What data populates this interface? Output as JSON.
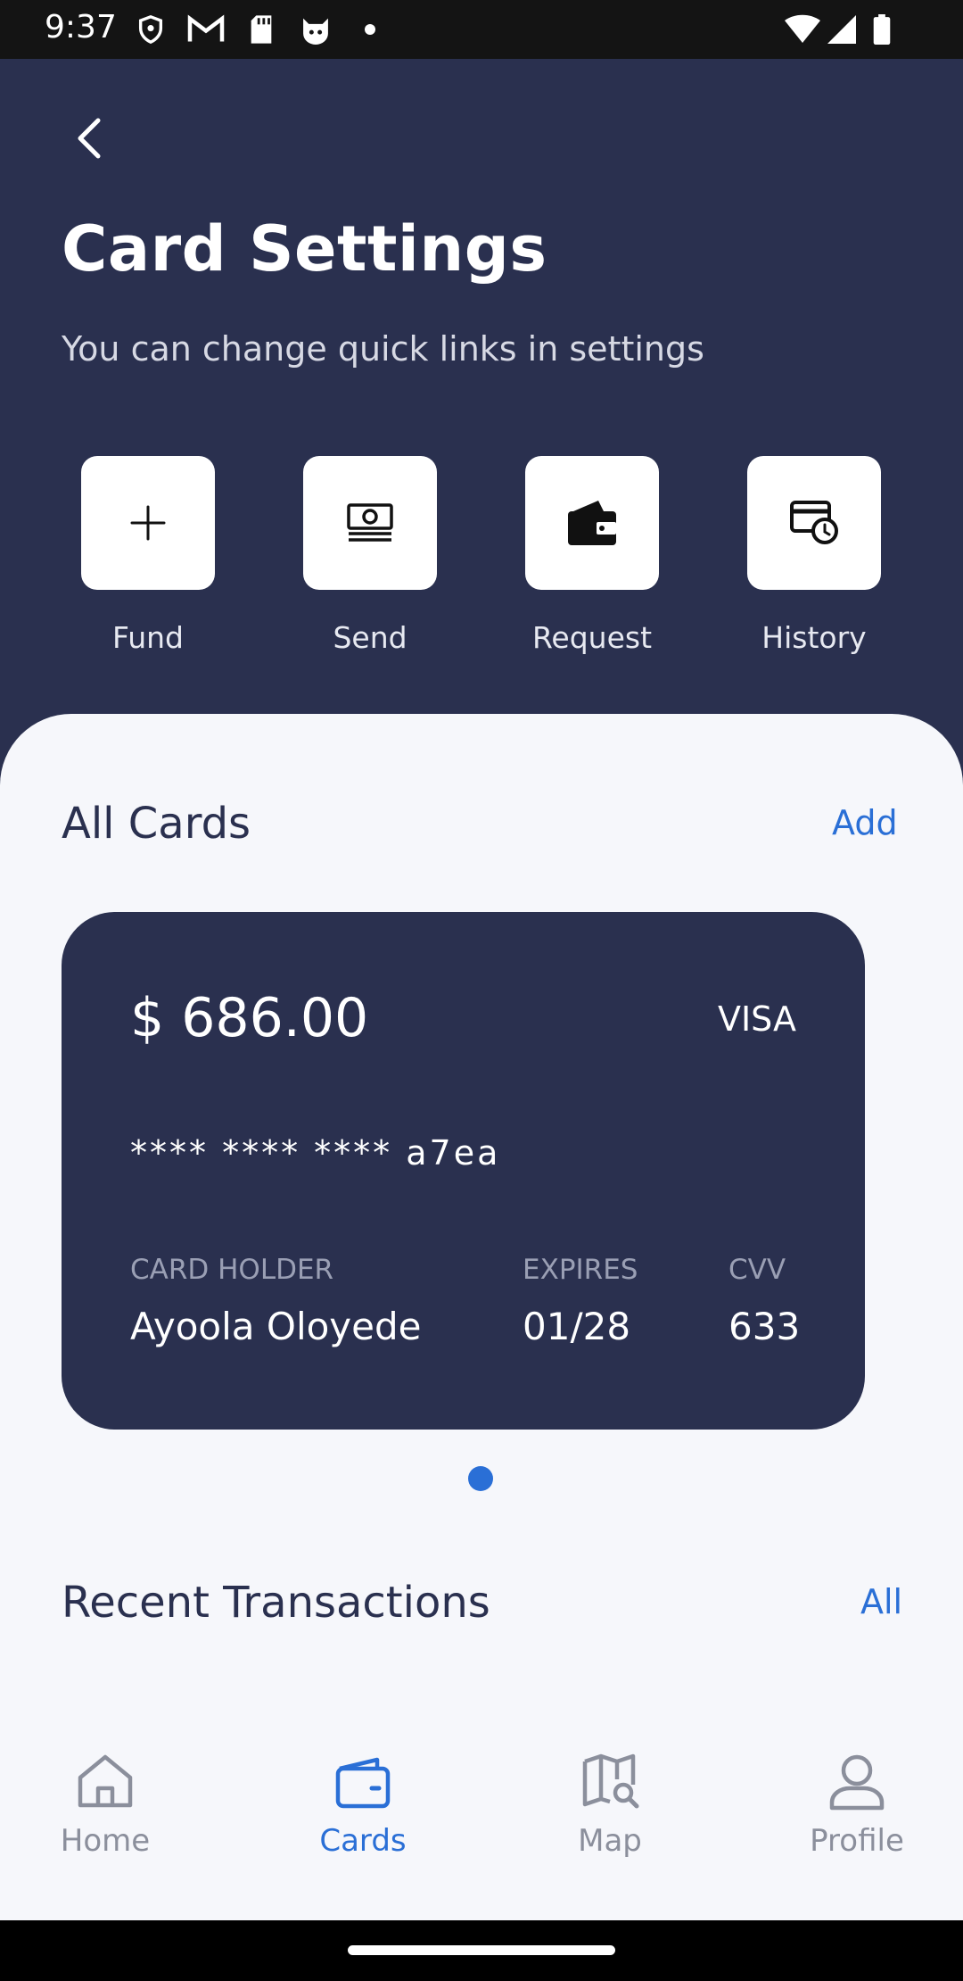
{
  "status_bar": {
    "time": "9:37",
    "left_icons": [
      "shield-icon",
      "gmail-icon",
      "sd-card-icon",
      "cat-icon",
      "dot-icon"
    ],
    "right_icons": [
      "wifi-icon",
      "signal-icon",
      "battery-icon"
    ]
  },
  "header": {
    "back_icon": "chevron-left-icon",
    "title": "Card Settings",
    "subtitle": "You can change quick links in settings"
  },
  "quick_links": [
    {
      "label": "Fund",
      "icon": "plus-icon"
    },
    {
      "label": "Send",
      "icon": "banknote-icon"
    },
    {
      "label": "Request",
      "icon": "wallet-icon"
    },
    {
      "label": "History",
      "icon": "card-clock-icon"
    }
  ],
  "cards_section": {
    "title": "All Cards",
    "action": "Add"
  },
  "card": {
    "balance": "$ 686.00",
    "brand": "VISA",
    "number": "**** **** **** a7ea",
    "holder_label": "CARD HOLDER",
    "holder": "Ayoola Oloyede",
    "expires_label": "EXPIRES",
    "expires": "01/28",
    "cvv_label": "CVV",
    "cvv": "633"
  },
  "carousel": {
    "pages": 1,
    "active": 1
  },
  "transactions_section": {
    "title": "Recent Transactions",
    "action": "All"
  },
  "bottom_nav": {
    "items": [
      {
        "label": "Home",
        "icon": "home-icon",
        "active": false
      },
      {
        "label": "Cards",
        "icon": "wallet-card-icon",
        "active": true
      },
      {
        "label": "Map",
        "icon": "map-search-icon",
        "active": false
      },
      {
        "label": "Profile",
        "icon": "user-icon",
        "active": false
      }
    ]
  },
  "colors": {
    "header_bg": "#2a304f",
    "panel_bg": "#f6f7fb",
    "accent": "#2a6fd6",
    "inactive": "#8b8f9c"
  }
}
